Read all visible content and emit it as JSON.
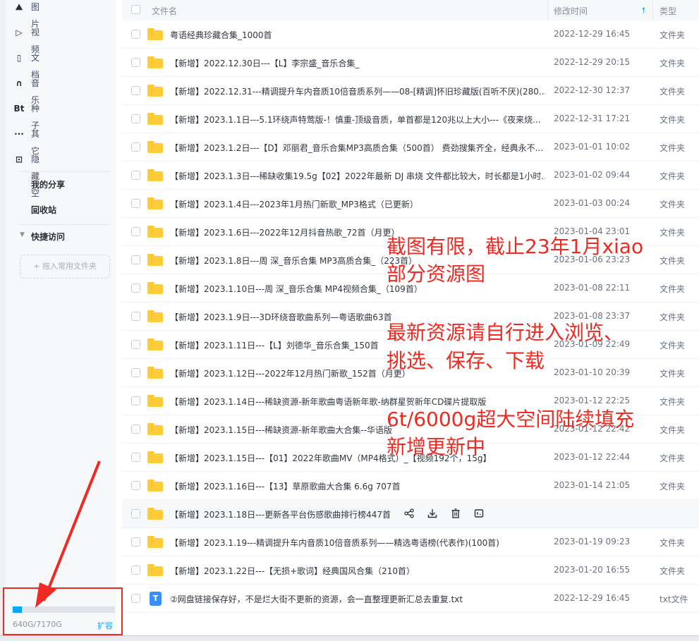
{
  "sidebar": {
    "items": [
      {
        "icon": "image-icon",
        "glyph": "⛰",
        "label": "图片"
      },
      {
        "icon": "video-icon",
        "glyph": "▷",
        "label": "视频"
      },
      {
        "icon": "document-icon",
        "glyph": "▯",
        "label": "文档"
      },
      {
        "icon": "headphones-icon",
        "glyph": "∩",
        "label": "音乐"
      },
      {
        "icon": "bt-icon",
        "glyph": "Bt",
        "label": "种子"
      },
      {
        "icon": "more-icon",
        "glyph": "···",
        "label": "其它"
      },
      {
        "icon": "lock-icon",
        "glyph": "⊡",
        "label": "隐藏空间"
      }
    ],
    "my_share": "我的分享",
    "recycle": "回收站",
    "quick_access": "快捷访问",
    "drop_hint": "+ 拖入常用文件夹",
    "storage": {
      "used_text": "640G/7170G",
      "used_fraction": 0.089,
      "expand": "扩容"
    }
  },
  "header": {
    "name": "文件名",
    "modified": "修改时间",
    "type": "类型"
  },
  "rows": [
    {
      "name": "粤语经典珍藏合集_1000首",
      "date": "2022-12-29 16:45",
      "type": "文件夹",
      "kind": "folder"
    },
    {
      "name": "【新增】2022.12.30日---【L】李宗盛_音乐合集_",
      "date": "2022-12-29 20:15",
      "type": "文件夹",
      "kind": "folder"
    },
    {
      "name": "【新增】2022.12.31---精调提升车内音质10倍音质系列——08-[精调]怀旧珍藏版(百听不厌)(280...",
      "date": "2022-12-30 12:37",
      "type": "文件夹",
      "kind": "folder"
    },
    {
      "name": "【新增】2023.1.1日---5.1环绕声特莺版-！慎重-顶级音质，单首都是120兆以上大小---《夜来烧...",
      "date": "2022-12-31 17:21",
      "type": "文件夹",
      "kind": "folder"
    },
    {
      "name": "【新增】2023.1.2日---【D】邓丽君_音乐合集MP3高质合集（500首） 费劲搜集齐全，经典永不...",
      "date": "2023-01-01 10:02",
      "type": "文件夹",
      "kind": "folder"
    },
    {
      "name": "【新增】2023.1.3日---稀缺收集19.5g【02】2022年最新 DJ 串烧 文件都比较大，时长都是1小时...",
      "date": "2023-01-02 09:44",
      "type": "文件夹",
      "kind": "folder"
    },
    {
      "name": "【新增】2023.1.4日---2023年1月热门新歌_MP3格式（已更新）",
      "date": "2023-01-03 00:24",
      "type": "文件夹",
      "kind": "folder"
    },
    {
      "name": "【新增】2023.1.6日---2022年12月抖音热歌_72首（月更）",
      "date": "2023-01-04 23:01",
      "type": "文件夹",
      "kind": "folder"
    },
    {
      "name": "【新增】2023.1.8日---周    深_音乐合集 MP3高质合集_（223首）",
      "date": "2023-01-06 23:23",
      "type": "文件夹",
      "kind": "folder"
    },
    {
      "name": "【新增】2023.1.10日---周    深_音乐合集 MP4视频合集_（109首）",
      "date": "2023-01-08 22:11",
      "type": "文件夹",
      "kind": "folder"
    },
    {
      "name": "【新增】2023.1.9日---3D环绕音歌曲系列—粤语歌曲63首",
      "date": "2023-01-08 23:37",
      "type": "文件夹",
      "kind": "folder"
    },
    {
      "name": "【新增】2023.1.11日---【L】刘德华_音乐合集_150首",
      "date": "2023-01-09 22:49",
      "type": "文件夹",
      "kind": "folder"
    },
    {
      "name": "【新增】2023.1.12日---2022年12月热门新歌_152首（月更）",
      "date": "2023-01-10 20:39",
      "type": "文件夹",
      "kind": "folder"
    },
    {
      "name": "【新增】2023.1.14日---稀缺资源-新年歌曲粤语新年歌-纳群星贺新年CD碟片提取版",
      "date": "2023-01-12 22:25",
      "type": "文件夹",
      "kind": "folder"
    },
    {
      "name": "【新增】2023.1.15日---稀缺资源-新年歌曲大合集--华语版",
      "date": "2023-01-12 22:42",
      "type": "文件夹",
      "kind": "folder"
    },
    {
      "name": "【新增】2023.1.15日---【01】2022年歌曲MV（MP4格式）_【视频192个，15g】",
      "date": "2023-01-12 22:44",
      "type": "文件夹",
      "kind": "folder"
    },
    {
      "name": "【新增】2023.1.16日---【13】草原歌曲大合集 6.6g 707首",
      "date": "2023-01-14 21:05",
      "type": "文件夹",
      "kind": "folder"
    },
    {
      "name": "【新增】2023.1.18日---更新各平台伤感歌曲排行榜447首",
      "date": "",
      "type": "",
      "kind": "folder",
      "hover": true
    },
    {
      "name": "【新增】2023.1.19---精调提升车内音质10倍音质系列——精选粤语榜(代表作)(100首)",
      "date": "2023-01-19 09:23",
      "type": "文件夹",
      "kind": "folder"
    },
    {
      "name": "【新增】2023.1.22日---【无损+歌词】经典国风合集（210首）",
      "date": "2023-01-20 16:55",
      "type": "文件夹",
      "kind": "folder"
    },
    {
      "name": "②网盘链接保存好，不是烂大街不更新的资源，会一直整理更新汇总去重复.txt",
      "date": "2022-12-29 16:45",
      "type": "txt文件",
      "kind": "txt"
    }
  ],
  "hover_actions": [
    "share-icon",
    "download-icon",
    "delete-icon",
    "more-actions-icon"
  ],
  "annotations": [
    "截图有限，截止23年1月xiao",
    "部分资源图",
    "最新资源请自行进入浏览、",
    "挑选、保存、下载",
    "6t/6000g超大空间陆续填充",
    "新增更新中"
  ],
  "colors": {
    "accent": "#06a7ff",
    "annotation_red": "#ee2a22",
    "folder_yellow": "#ffcc38"
  }
}
